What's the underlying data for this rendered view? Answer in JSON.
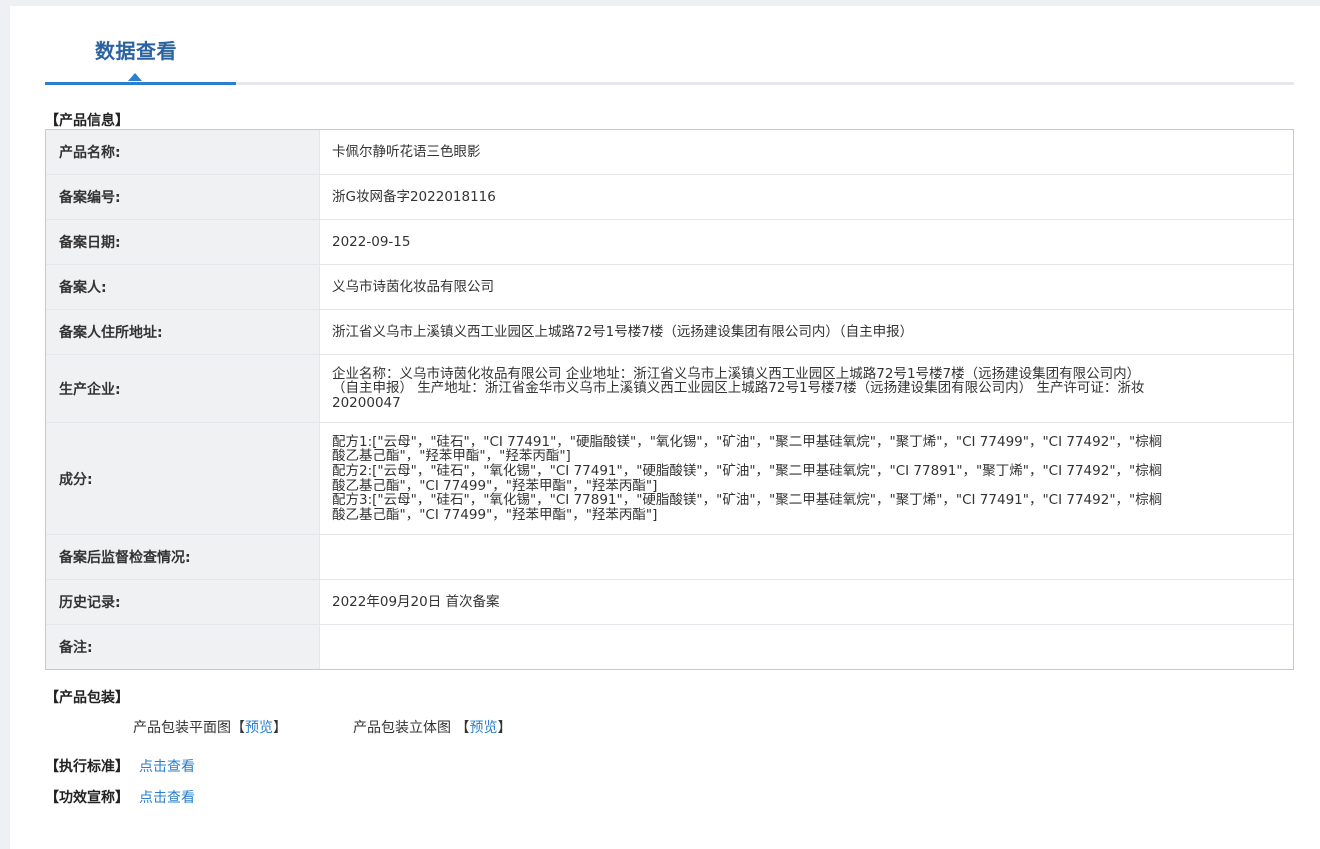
{
  "tab": {
    "title": "数据查看"
  },
  "product_info": {
    "section_title": "【产品信息】",
    "rows": [
      {
        "label": "产品名称:",
        "value": "卡佩尔静听花语三色眼影"
      },
      {
        "label": "备案编号:",
        "value": "浙G妆网备字2022018116"
      },
      {
        "label": "备案日期:",
        "value": "2022-09-15"
      },
      {
        "label": "备案人:",
        "value": "义乌市诗茵化妆品有限公司"
      },
      {
        "label": "备案人住所地址:",
        "value": "浙江省义乌市上溪镇义西工业园区上城路72号1号楼7楼（远扬建设集团有限公司内）（自主申报）"
      },
      {
        "label": "生产企业:",
        "value": "企业名称：义乌市诗茵化妆品有限公司 企业地址：浙江省义乌市上溪镇义西工业园区上城路72号1号楼7楼（远扬建设集团有限公司内）\n（自主申报） 生产地址：浙江省金华市义乌市上溪镇义西工业园区上城路72号1号楼7楼（远扬建设集团有限公司内） 生产许可证：浙妆\n20200047"
      },
      {
        "label": "成分:",
        "value": "配方1:[\"云母\"，\"硅石\"，\"CI 77491\"，\"硬脂酸镁\"，\"氧化锡\"，\"矿油\"，\"聚二甲基硅氧烷\"，\"聚丁烯\"，\"CI 77499\"，\"CI 77492\"，\"棕榈\n酸乙基己酯\"，\"羟苯甲酯\"，\"羟苯丙酯\"]\n配方2:[\"云母\"，\"硅石\"，\"氧化锡\"，\"CI 77491\"，\"硬脂酸镁\"，\"矿油\"，\"聚二甲基硅氧烷\"，\"CI 77891\"，\"聚丁烯\"，\"CI 77492\"，\"棕榈\n酸乙基己酯\"，\"CI 77499\"，\"羟苯甲酯\"，\"羟苯丙酯\"]\n配方3:[\"云母\"，\"硅石\"，\"氧化锡\"，\"CI 77891\"，\"硬脂酸镁\"，\"矿油\"，\"聚二甲基硅氧烷\"，\"聚丁烯\"，\"CI 77491\"，\"CI 77492\"，\"棕榈\n酸乙基己酯\"，\"CI 77499\"，\"羟苯甲酯\"，\"羟苯丙酯\"]"
      },
      {
        "label": "备案后监督检查情况:",
        "value": ""
      },
      {
        "label": "历史记录:",
        "value": "2022年09月20日 首次备案"
      },
      {
        "label": "备注:",
        "value": ""
      }
    ]
  },
  "packaging": {
    "section_title": "【产品包装】",
    "flat_label": "产品包装平面图",
    "flat_open": "【",
    "flat_link": "预览",
    "flat_close": "】",
    "stereo_label": "产品包装立体图 ",
    "stereo_open": "【",
    "stereo_link": "预览",
    "stereo_close": "】"
  },
  "standard": {
    "label": "【执行标准】",
    "link": "点击查看"
  },
  "efficacy": {
    "label": "【功效宣称】",
    "link": "点击查看"
  }
}
